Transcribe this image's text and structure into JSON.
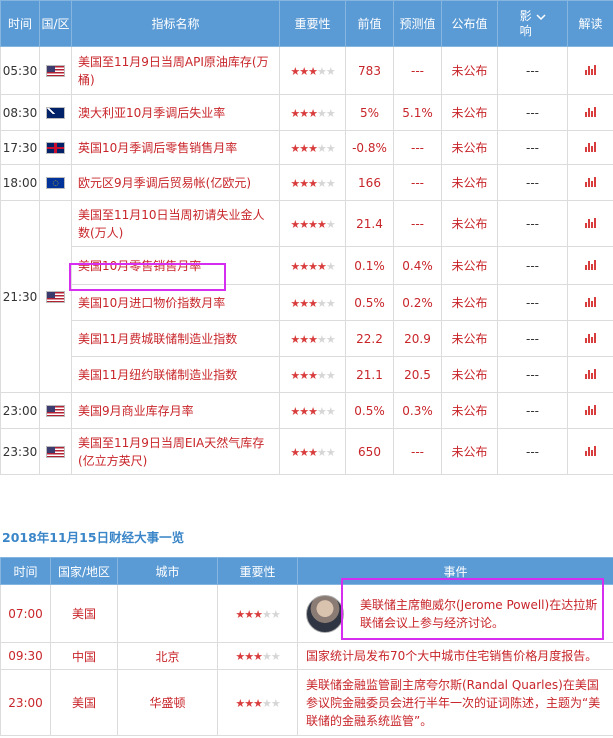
{
  "calendar": {
    "headers": {
      "time": "时间",
      "region": "国/区",
      "name": "指标名称",
      "importance": "重要性",
      "previous": "前值",
      "forecast": "预测值",
      "actual": "公布值",
      "impact": "影响",
      "analysis": "解读"
    },
    "impact_dropdown_icon": "chevron-down-icon",
    "rows": [
      {
        "time": "05:30",
        "flag": "us-flag",
        "name": "美国至11月9日当周API原油库存(万桶)",
        "stars": 3,
        "previous": "783",
        "forecast": "---",
        "actual": "未公布",
        "impact": "---"
      },
      {
        "time": "08:30",
        "flag": "au-flag",
        "name": "澳大利亚10月季调后失业率",
        "stars": 3,
        "previous": "5%",
        "forecast": "5.1%",
        "actual": "未公布",
        "impact": "---"
      },
      {
        "time": "17:30",
        "flag": "uk-flag",
        "name": "英国10月季调后零售销售月率",
        "stars": 3,
        "previous": "-0.8%",
        "forecast": "---",
        "actual": "未公布",
        "impact": "---"
      },
      {
        "time": "18:00",
        "flag": "eu-flag",
        "name": "欧元区9月季调后贸易帐(亿欧元)",
        "stars": 3,
        "previous": "166",
        "forecast": "---",
        "actual": "未公布",
        "impact": "---"
      },
      {
        "time": "21:30",
        "flag": "us-flag",
        "name": "美国至11月10日当周初请失业金人数(万人)",
        "stars": 4,
        "previous": "21.4",
        "forecast": "---",
        "actual": "未公布",
        "impact": "---"
      },
      {
        "time": "",
        "flag": "",
        "name": "美国10月零售销售月率",
        "stars": 4,
        "previous": "0.1%",
        "forecast": "0.4%",
        "actual": "未公布",
        "impact": "---"
      },
      {
        "time": "",
        "flag": "",
        "name": "美国10月进口物价指数月率",
        "stars": 3,
        "previous": "0.5%",
        "forecast": "0.2%",
        "actual": "未公布",
        "impact": "---"
      },
      {
        "time": "",
        "flag": "",
        "name": "美国11月费城联储制造业指数",
        "stars": 3,
        "previous": "22.2",
        "forecast": "20.9",
        "actual": "未公布",
        "impact": "---"
      },
      {
        "time": "",
        "flag": "",
        "name": "美国11月纽约联储制造业指数",
        "stars": 3,
        "previous": "21.1",
        "forecast": "20.5",
        "actual": "未公布",
        "impact": "---"
      },
      {
        "time": "23:00",
        "flag": "us-flag",
        "name": "美国9月商业库存月率",
        "stars": 3,
        "previous": "0.5%",
        "forecast": "0.3%",
        "actual": "未公布",
        "impact": "---"
      },
      {
        "time": "23:30",
        "flag": "us-flag",
        "name": "美国至11月9日当周EIA天然气库存(亿立方英尺)",
        "stars": 3,
        "previous": "650",
        "forecast": "---",
        "actual": "未公布",
        "impact": "---"
      }
    ]
  },
  "events": {
    "title": "2018年11月15日财经大事一览",
    "headers": {
      "time": "时间",
      "country": "国家/地区",
      "city": "城市",
      "importance": "重要性",
      "event": "事件"
    },
    "rows": [
      {
        "time": "07:00",
        "country": "美国",
        "city": "",
        "stars": 3,
        "avatar": true,
        "event": "美联储主席鲍威尔(Jerome Powell)在达拉斯联储会议上参与经济讨论。"
      },
      {
        "time": "09:30",
        "country": "中国",
        "city": "北京",
        "stars": 3,
        "avatar": false,
        "event": "国家统计局发布70个大中城市住宅销售价格月度报告。"
      },
      {
        "time": "23:00",
        "country": "美国",
        "city": "华盛顿",
        "stars": 3,
        "avatar": false,
        "event": "美联储金融监管副主席夸尔斯(Randal Quarles)在美国参议院金融委员会进行半年一次的证词陈述，主题为“美联储的金融系统监管”。"
      }
    ]
  },
  "colors": {
    "header_bg": "#5b9bd5",
    "indicator_text": "#c8252a",
    "star_on": "#d93c3c",
    "highlight": "#d62ef0",
    "section_title": "#3a86c8"
  }
}
